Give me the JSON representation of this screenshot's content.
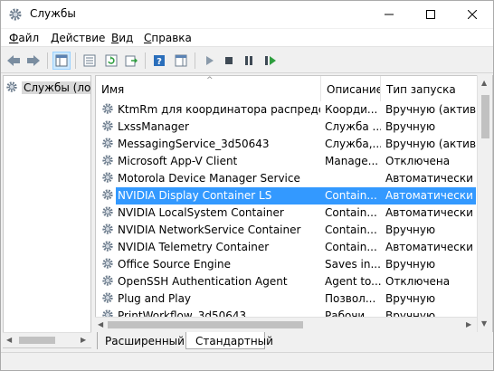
{
  "window": {
    "title": "Службы"
  },
  "menu": [
    {
      "label": "Файл",
      "ul": "Ф",
      "rest": "айл"
    },
    {
      "label": "Действие",
      "ul": "Д",
      "rest": "ействие"
    },
    {
      "label": "Вид",
      "ul": "В",
      "rest": "ид"
    },
    {
      "label": "Справка",
      "ul": "С",
      "rest": "правка"
    }
  ],
  "left_pane": {
    "item": "Службы (локальные)"
  },
  "columns": {
    "name": "Имя",
    "description": "Описание",
    "startup": "Тип запуска"
  },
  "services": [
    {
      "name": "KtmRm для координатора распределе...",
      "description": "Коорди...",
      "startup": "Вручную (активир"
    },
    {
      "name": "LxssManager",
      "description": "Служба ...",
      "startup": "Вручную"
    },
    {
      "name": "MessagingService_3d50643",
      "description": "Служба,...",
      "startup": "Вручную (активир"
    },
    {
      "name": "Microsoft App-V Client",
      "description": "Manage...",
      "startup": "Отключена"
    },
    {
      "name": "Motorola Device Manager Service",
      "description": "",
      "startup": "Автоматически"
    },
    {
      "name": "NVIDIA Display Container LS",
      "description": "Contain...",
      "startup": "Автоматически",
      "selected": true
    },
    {
      "name": "NVIDIA LocalSystem Container",
      "description": "Contain...",
      "startup": "Автоматически"
    },
    {
      "name": "NVIDIA NetworkService Container",
      "description": "Contain...",
      "startup": "Вручную"
    },
    {
      "name": "NVIDIA Telemetry Container",
      "description": "Contain...",
      "startup": "Автоматически"
    },
    {
      "name": "Office  Source Engine",
      "description": "Saves in...",
      "startup": "Вручную"
    },
    {
      "name": "OpenSSH Authentication Agent",
      "description": "Agent to...",
      "startup": "Отключена"
    },
    {
      "name": "Plug and Play",
      "description": "Позвол...",
      "startup": "Вручную"
    },
    {
      "name": "PrintWorkflow_3d50643",
      "description": "Рабочи...",
      "startup": "Вручную"
    }
  ],
  "tabs": {
    "extended": "Расширенный",
    "standard": "Стандартный"
  },
  "colors": {
    "selection": "#3399ff",
    "accent_green": "#2e9e3e",
    "accent_blue": "#2a6ebb"
  }
}
